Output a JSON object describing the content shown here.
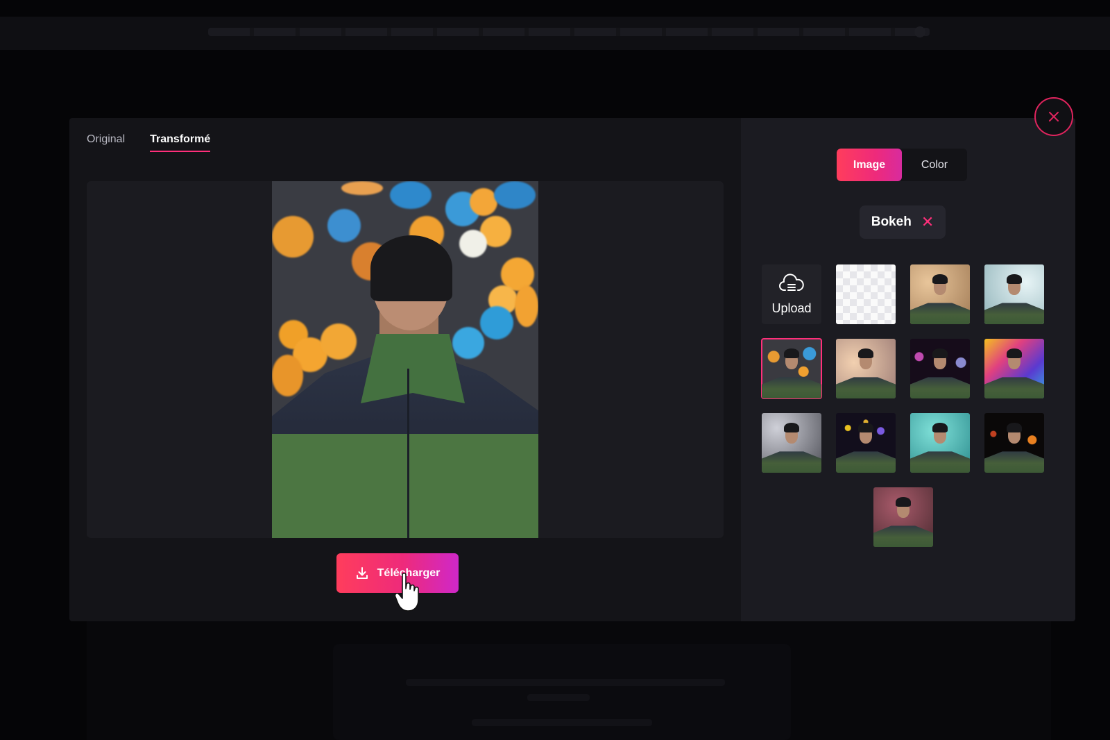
{
  "preview": {
    "tabs": [
      {
        "label": "Original",
        "active": false
      },
      {
        "label": "Transformé",
        "active": true
      }
    ],
    "download_label": "Télécharger"
  },
  "panel": {
    "toggle": [
      {
        "label": "Image",
        "active": true
      },
      {
        "label": "Color",
        "active": false
      }
    ],
    "category_chip": "Bokeh",
    "upload_label": "Upload",
    "backgrounds": [
      {
        "name": "transparent",
        "bg": "checkerboard"
      },
      {
        "name": "warm-gold-bokeh",
        "bg": "#b89068"
      },
      {
        "name": "cool-silver-bokeh",
        "bg": "#9fc2c6"
      },
      {
        "name": "orange-blue-bokeh",
        "bg": "#3b3a3f",
        "selected": true
      },
      {
        "name": "soft-pastel-bokeh",
        "bg": "#c6a59a"
      },
      {
        "name": "dark-purple-bokeh",
        "bg": "#1a1020"
      },
      {
        "name": "rainbow-bokeh",
        "bg": "#8a46c0"
      },
      {
        "name": "grey-bokeh",
        "bg": "#55565e"
      },
      {
        "name": "glitter-bokeh",
        "bg": "#141020"
      },
      {
        "name": "teal-bokeh",
        "bg": "#2f9a9a"
      },
      {
        "name": "black-gold-bokeh",
        "bg": "#0e0a0a"
      },
      {
        "name": "rose-bokeh",
        "bg": "#6a3a45"
      }
    ]
  },
  "colors": {
    "accent": "#ff2f7a",
    "gradient_start": "#ff3d5c",
    "gradient_end": "#cf28c9",
    "modal_left": "#141418",
    "modal_right": "#1b1b21"
  },
  "icons": [
    "close-icon",
    "download-icon",
    "cloud-upload-icon",
    "hand-pointer-cursor-icon"
  ]
}
